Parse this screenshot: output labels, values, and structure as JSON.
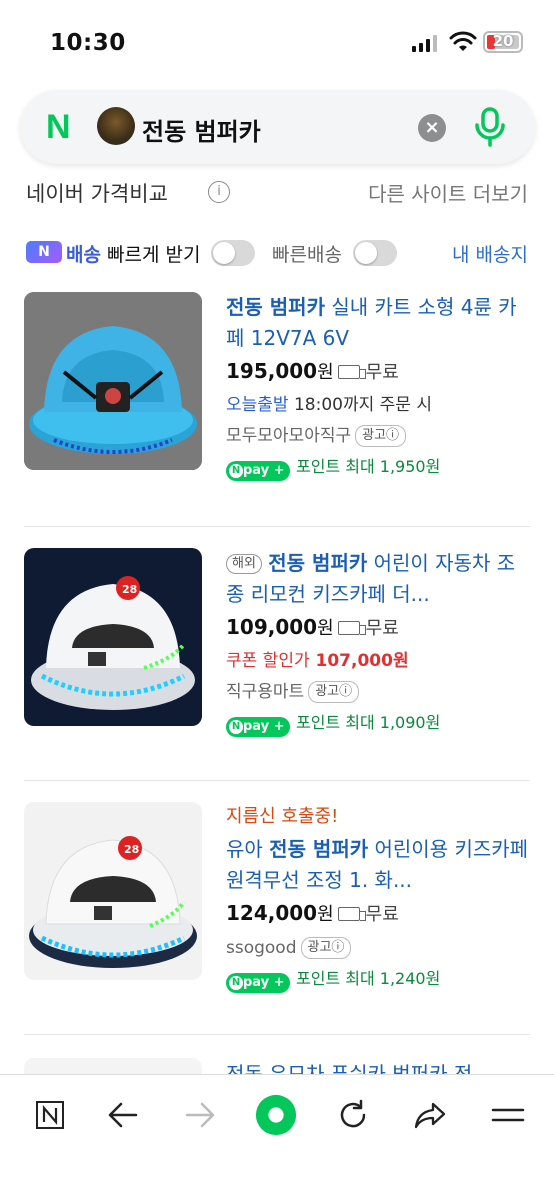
{
  "status": {
    "time": "10:30",
    "battery": "20"
  },
  "search": {
    "logo": "N",
    "query": "전동 범퍼카",
    "clear": "×"
  },
  "section": {
    "title": "네이버 가격비교",
    "info": "i",
    "other_sites": "다른 사이트 더보기"
  },
  "filters": {
    "badge": "N",
    "label1_blue": "배송",
    "label1_rest": " 빠르게 받기",
    "label2": "빠른배송",
    "my_address": "내 배송지"
  },
  "products": [
    {
      "promo": "",
      "tag": "",
      "title_bold": "전동 범퍼카",
      "title_rest": " 실내 카트 소형 4륜 카페 12V7A 6V",
      "price": "195,000",
      "won": "원",
      "shipping": "무료",
      "line2_a": "오늘출발",
      "line2_b": " 18:00까지 주문 시",
      "seller": "모두모아모아직구",
      "ad": "광고ⓘ",
      "npay_label": "pay",
      "points": "포인트 최대 1,950원",
      "image_color": "#3fb3e6"
    },
    {
      "promo": "",
      "tag": "해외",
      "title_bold": "전동 범퍼카",
      "title_rest": " 어린이 자동차 조종 리모컨 키즈카페 더...",
      "price": "109,000",
      "won": "원",
      "shipping": "무료",
      "line2_a": "쿠폰 할인가",
      "line2_b": " 107,000원",
      "seller": "직구용마트",
      "ad": "광고ⓘ",
      "npay_label": "pay",
      "points": "포인트 최대 1,090원",
      "image_color": "#0f1b33"
    },
    {
      "promo": "지름신 호출중!",
      "tag": "",
      "title_pre": "유아 ",
      "title_bold": "전동 범퍼카",
      "title_rest": " 어린이용 키즈카페 원격무선 조정 1. 화...",
      "price": "124,000",
      "won": "원",
      "shipping": "무료",
      "seller": "ssogood",
      "ad": "광고ⓘ",
      "npay_label": "pay",
      "points": "포인트 최대 1,240원",
      "image_color": "#f2f2f2"
    }
  ],
  "peek_title": "전동 유모차 푸쉬카 범퍼카 전",
  "toolbar": {
    "n_label": "N"
  }
}
